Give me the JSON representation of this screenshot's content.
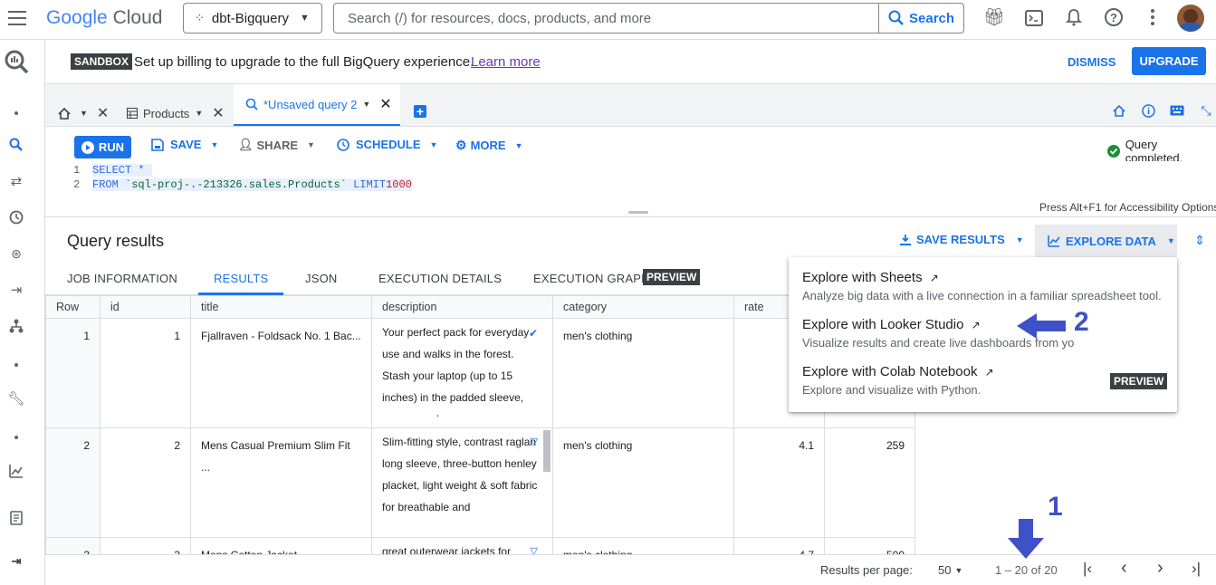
{
  "topbar": {
    "logo_google": "Google",
    "logo_cloud": "Cloud",
    "project": "dbt-Bigquery",
    "search_placeholder": "Search (/) for resources, docs, products, and more",
    "search_button": "Search"
  },
  "sandbox": {
    "badge": "SANDBOX",
    "message": "Set up billing to upgrade to the full BigQuery experience.",
    "learn_more": "Learn more",
    "dismiss": "DISMISS",
    "upgrade": "UPGRADE"
  },
  "tabs": [
    {
      "label": "Products"
    },
    {
      "label": "*Unsaved query 2"
    }
  ],
  "toolbar": {
    "run": "RUN",
    "save": "SAVE",
    "share": "SHARE",
    "schedule": "SCHEDULE",
    "more": "MORE",
    "status": "Query completed."
  },
  "editor": {
    "line1_no": "1",
    "line1": "SELECT *",
    "line2_no": "2",
    "line2_kw": "FROM",
    "line2_ref": "`sql-proj-.-213326.sales.Products`",
    "line2_limit": "LIMIT",
    "line2_num": "1000",
    "accessibility": "Press Alt+F1 for Accessibility Options"
  },
  "results": {
    "title": "Query results",
    "save_results": "SAVE RESULTS",
    "explore_data": "EXPLORE DATA",
    "tabs": [
      "JOB INFORMATION",
      "RESULTS",
      "JSON",
      "EXECUTION DETAILS",
      "EXECUTION GRAPH"
    ],
    "preview": "PREVIEW",
    "columns": [
      "Row",
      "id",
      "title",
      "description",
      "category",
      "rate",
      ""
    ],
    "rows": [
      {
        "row": "1",
        "id": "1",
        "title": "Fjallraven - Foldsack No. 1 Bac...",
        "description": "Your perfect pack for everyday use and walks in the forest. Stash your laptop (up to 15 inches) in the padded sleeve, your everyday...",
        "category": "men's clothing",
        "rate": "",
        "count": ""
      },
      {
        "row": "2",
        "id": "2",
        "title": "Mens Casual Premium Slim Fit ...",
        "description": "Slim-fitting style, contrast raglan long sleeve, three-button henley placket, light weight & soft fabric for breathable and",
        "category": "men's clothing",
        "rate": "4.1",
        "count": "259"
      },
      {
        "row": "3",
        "id": "3",
        "title": "Mens Cotton Jacket",
        "description": "great outerwear jackets for",
        "category": "men's clothing",
        "rate": "4.7",
        "count": "500"
      }
    ]
  },
  "menu": [
    {
      "title": "Explore with Sheets",
      "desc": "Analyze big data with a live connection in a familiar spreadsheet tool."
    },
    {
      "title": "Explore with Looker Studio",
      "desc": "Visualize results and create live dashboards from yo"
    },
    {
      "title": "Explore with Colab Notebook",
      "desc": "Explore and visualize with Python.",
      "badge": "PREVIEW"
    }
  ],
  "footer": {
    "per_page_label": "Results per page:",
    "per_page": "50",
    "range": "1 – 20 of 20"
  },
  "annotations": {
    "one": "1",
    "two": "2"
  },
  "colors": {
    "accent": "#1a73e8",
    "annotation": "#3f51c6"
  }
}
